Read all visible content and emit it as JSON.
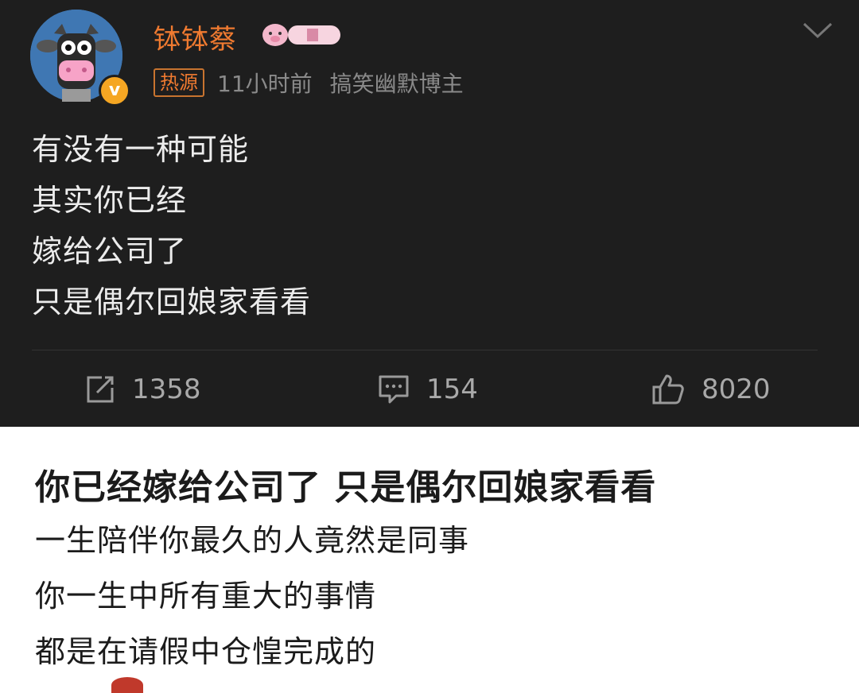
{
  "post": {
    "username": "钵钵蔡",
    "hot_tag": "热源",
    "time": "11小时前",
    "category": "搞笑幽默博主",
    "verified_mark": "v",
    "body_lines": [
      "有没有一种可能",
      "其实你已经",
      "嫁给公司了",
      "只是偶尔回娘家看看"
    ],
    "actions": {
      "repost_count": "1358",
      "comment_count": "154",
      "like_count": "8020"
    },
    "icons": {
      "repost": "repost-icon",
      "comment": "comment-icon",
      "like": "thumbs-up-icon",
      "menu": "chevron-down-icon",
      "vip": "vip-pig-badge-icon"
    },
    "colors": {
      "background": "#1e1e1e",
      "username": "#ef7a30",
      "verified": "#f5a623"
    }
  },
  "article": {
    "title": "你已经嫁给公司了 只是偶尔回娘家看看",
    "lines": [
      "一生陪伴你最久的人竟然是同事",
      "你一生中所有重大的事情",
      "都是在请假中仓惶完成的"
    ]
  }
}
